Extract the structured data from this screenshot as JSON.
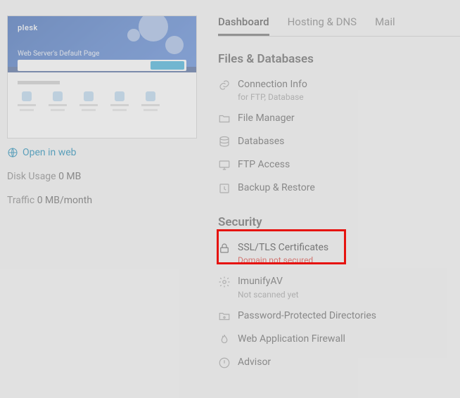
{
  "thumbnail": {
    "logo": "plesk",
    "heading": "Web Server's Default Page"
  },
  "open_web_label": "Open in web",
  "stats": {
    "disk_label": "Disk Usage",
    "disk_value": "0 MB",
    "traffic_label": "Traffic",
    "traffic_value": "0 MB/month"
  },
  "tabs": {
    "dashboard": "Dashboard",
    "hosting": "Hosting & DNS",
    "mail": "Mail"
  },
  "sections": {
    "files": {
      "title": "Files & Databases",
      "items": [
        {
          "label": "Connection Info",
          "sub": "for FTP, Database"
        },
        {
          "label": "File Manager"
        },
        {
          "label": "Databases"
        },
        {
          "label": "FTP Access"
        },
        {
          "label": "Backup & Restore"
        }
      ]
    },
    "security": {
      "title": "Security",
      "items": [
        {
          "label": "SSL/TLS Certificates",
          "sub": "Domain not secured"
        },
        {
          "label": "ImunifyAV",
          "sub": "Not scanned yet"
        },
        {
          "label": "Password-Protected Directories"
        },
        {
          "label": "Web Application Firewall"
        },
        {
          "label": "Advisor"
        }
      ]
    }
  }
}
